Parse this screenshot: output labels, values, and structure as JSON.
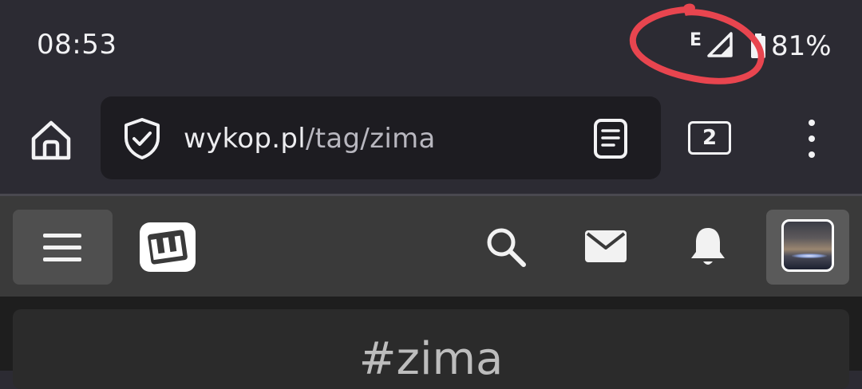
{
  "status_bar": {
    "time": "08:53",
    "network_type": "E",
    "signal_icon": "signal-icon",
    "battery_icon": "battery-icon",
    "battery_percent": "81%"
  },
  "browser": {
    "home_icon": "home-icon",
    "security_icon": "shield-check-icon",
    "url_host": "wykop.pl",
    "url_path": "/tag/zima",
    "reader_icon": "reader-mode-icon",
    "tab_count": "2",
    "menu_icon": "more-vertical-icon"
  },
  "site_header": {
    "menu_icon": "hamburger-icon",
    "logo_icon": "wykop-logo-icon",
    "search_icon": "search-icon",
    "messages_icon": "mail-icon",
    "notifications_icon": "bell-icon",
    "avatar_icon": "user-avatar"
  },
  "content": {
    "tag_title": "#zima"
  },
  "colors": {
    "browser_bg": "#2c2b33",
    "urlbar_bg": "#1d1c21",
    "site_header_bg": "#3a3a3a",
    "content_bg": "#1e1e1e",
    "annotation_red": "#e8454f"
  }
}
